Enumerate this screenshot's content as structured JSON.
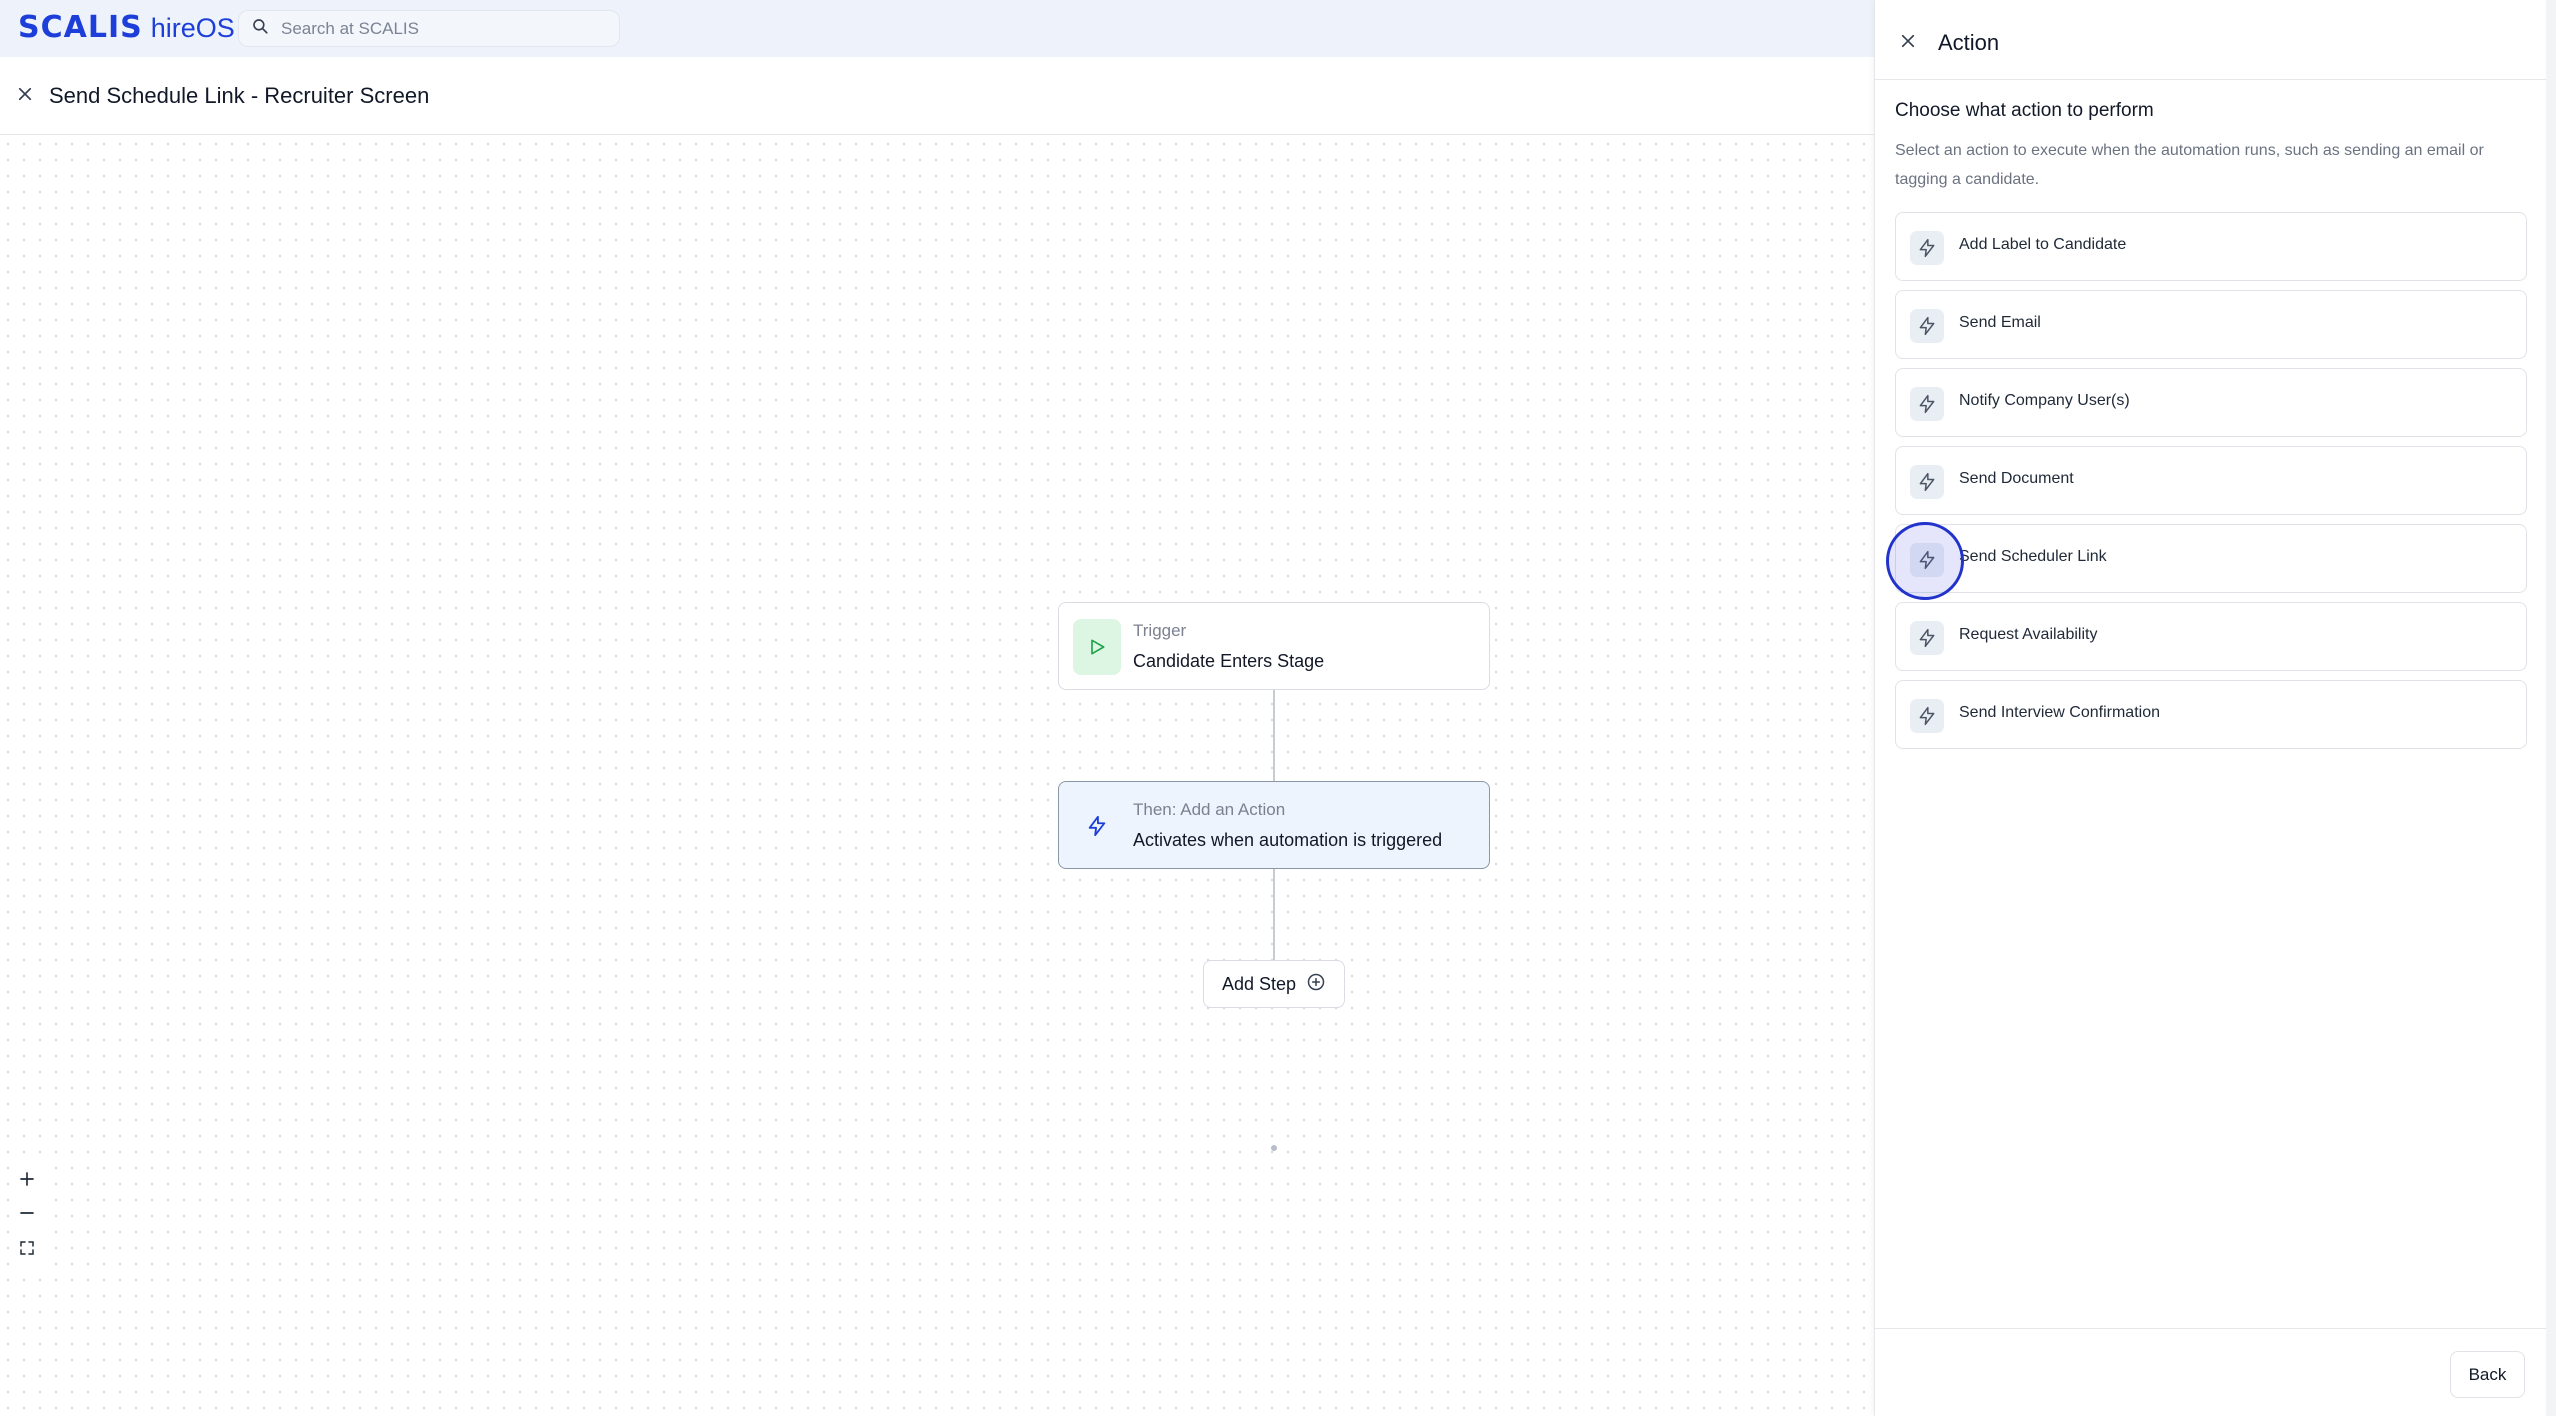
{
  "app": {
    "brand": "SCALIS",
    "product": "hireOS",
    "search_placeholder": "Search at SCALIS"
  },
  "editor": {
    "title": "Send Schedule Link - Recruiter Screen"
  },
  "workflow": {
    "trigger": {
      "label": "Trigger",
      "value": "Candidate Enters Stage"
    },
    "action": {
      "label": "Then: Add an Action",
      "value": "Activates when automation is triggered"
    },
    "add_step_label": "Add Step"
  },
  "panel": {
    "title": "Action",
    "section_title": "Choose what action to perform",
    "section_description": "Select an action to execute when the automation runs, such as sending an email or tagging a candidate.",
    "actions": [
      {
        "label": "Add Label to Candidate",
        "icon": "bolt-icon"
      },
      {
        "label": "Send Email",
        "icon": "bolt-icon"
      },
      {
        "label": "Notify Company User(s)",
        "icon": "bolt-icon"
      },
      {
        "label": "Send Document",
        "icon": "bolt-icon"
      },
      {
        "label": "Send Scheduler Link",
        "icon": "bolt-icon"
      },
      {
        "label": "Request Availability",
        "icon": "bolt-icon"
      },
      {
        "label": "Send Interview Confirmation",
        "icon": "bolt-icon"
      }
    ],
    "back_label": "Back"
  },
  "colors": {
    "brand": "#1d3ed8",
    "trigger_icon_bg": "#dcf6e3",
    "trigger_icon": "#22a34a",
    "action_node_bg": "#eef4fd",
    "cursor_ring": "#2233cc"
  }
}
